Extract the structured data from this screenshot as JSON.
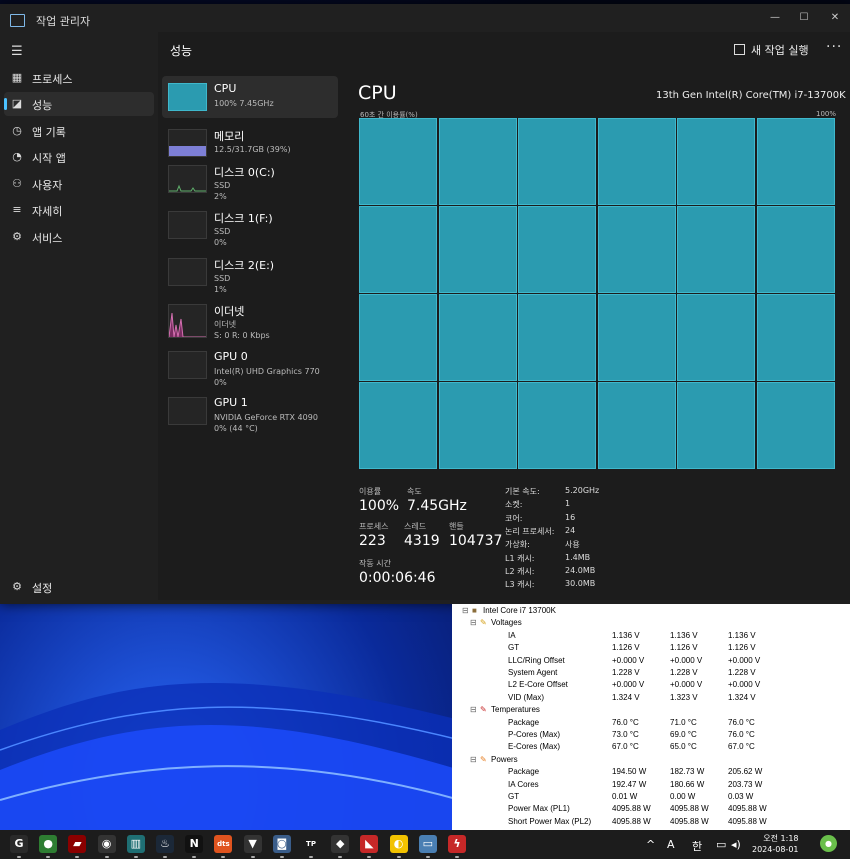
{
  "window": {
    "title": "작업 관리자"
  },
  "nav": {
    "items": [
      {
        "label": "프로세스",
        "icon": "processes-icon"
      },
      {
        "label": "성능",
        "icon": "performance-icon"
      },
      {
        "label": "앱 기록",
        "icon": "app-history-icon"
      },
      {
        "label": "시작 앱",
        "icon": "startup-apps-icon"
      },
      {
        "label": "사용자",
        "icon": "users-icon"
      },
      {
        "label": "자세히",
        "icon": "details-icon"
      },
      {
        "label": "서비스",
        "icon": "services-icon"
      }
    ],
    "settings": "설정"
  },
  "header": {
    "title": "성능",
    "run_task": "새 작업 실행",
    "more": "···"
  },
  "resources": [
    {
      "name": "CPU",
      "sub1": "100% 7.45GHz",
      "sub2": ""
    },
    {
      "name": "메모리",
      "sub1": "12.5/31.7GB (39%)",
      "sub2": ""
    },
    {
      "name": "디스크 0(C:)",
      "sub1": "SSD",
      "sub2": "2%"
    },
    {
      "name": "디스크 1(F:)",
      "sub1": "SSD",
      "sub2": "0%"
    },
    {
      "name": "디스크 2(E:)",
      "sub1": "SSD",
      "sub2": "1%"
    },
    {
      "name": "이더넷",
      "sub1": "이더넷",
      "sub2": "S: 0 R: 0 Kbps"
    },
    {
      "name": "GPU 0",
      "sub1": "Intel(R) UHD Graphics 770",
      "sub2": "0%"
    },
    {
      "name": "GPU 1",
      "sub1": "NVIDIA GeForce RTX 4090",
      "sub2": "0% (44 °C)"
    }
  ],
  "memory_fraction": 0.39,
  "cpu": {
    "heading": "CPU",
    "model": "13th Gen Intel(R) Core(TM) i7-13700K",
    "graph_label": "60초 간 이용률(%)",
    "graph_max": "100%",
    "core_graph_count": 24,
    "core_utilization": 1.0,
    "stats": {
      "util_label": "이용률",
      "util": "100%",
      "speed_label": "속도",
      "speed": "7.45GHz",
      "proc_label": "프로세스",
      "proc": "223",
      "thread_label": "스레드",
      "thread": "4319",
      "handle_label": "핸들",
      "handle": "104737",
      "uptime_label": "작동 시간",
      "uptime": "0:00:06:46"
    },
    "specs": [
      {
        "k": "기본 속도:",
        "v": "5.20GHz"
      },
      {
        "k": "소켓:",
        "v": "1"
      },
      {
        "k": "코어:",
        "v": "16"
      },
      {
        "k": "논리 프로세서:",
        "v": "24"
      },
      {
        "k": "가상화:",
        "v": "사용"
      },
      {
        "k": "L1 캐시:",
        "v": "1.4MB"
      },
      {
        "k": "L2 캐시:",
        "v": "24.0MB"
      },
      {
        "k": "L3 캐시:",
        "v": "30.0MB"
      }
    ]
  },
  "hwinfo": {
    "rows": [
      {
        "label": "Intel Core i7 13700K",
        "c1": "",
        "c2": "",
        "c3": "",
        "level": 0
      },
      {
        "label": "Voltages",
        "c1": "",
        "c2": "",
        "c3": "",
        "level": 1
      },
      {
        "label": "IA",
        "c1": "1.136 V",
        "c2": "1.136 V",
        "c3": "1.136 V",
        "level": 2
      },
      {
        "label": "GT",
        "c1": "1.126 V",
        "c2": "1.126 V",
        "c3": "1.126 V",
        "level": 2
      },
      {
        "label": "LLC/Ring Offset",
        "c1": "+0.000 V",
        "c2": "+0.000 V",
        "c3": "+0.000 V",
        "level": 2
      },
      {
        "label": "System Agent",
        "c1": "1.228 V",
        "c2": "1.228 V",
        "c3": "1.228 V",
        "level": 2
      },
      {
        "label": "L2 E-Core Offset",
        "c1": "+0.000 V",
        "c2": "+0.000 V",
        "c3": "+0.000 V",
        "level": 2
      },
      {
        "label": "VID (Max)",
        "c1": "1.324 V",
        "c2": "1.323 V",
        "c3": "1.324 V",
        "level": 2
      },
      {
        "label": "Temperatures",
        "c1": "",
        "c2": "",
        "c3": "",
        "level": 1
      },
      {
        "label": "Package",
        "c1": "76.0 °C",
        "c2": "71.0 °C",
        "c3": "76.0 °C",
        "level": 2
      },
      {
        "label": "P-Cores (Max)",
        "c1": "73.0 °C",
        "c2": "69.0 °C",
        "c3": "76.0 °C",
        "level": 2
      },
      {
        "label": "E-Cores (Max)",
        "c1": "67.0 °C",
        "c2": "65.0 °C",
        "c3": "67.0 °C",
        "level": 2
      },
      {
        "label": "Powers",
        "c1": "",
        "c2": "",
        "c3": "",
        "level": 1
      },
      {
        "label": "Package",
        "c1": "194.50 W",
        "c2": "182.73 W",
        "c3": "205.62 W",
        "level": 2
      },
      {
        "label": "IA Cores",
        "c1": "192.47 W",
        "c2": "180.66 W",
        "c3": "203.73 W",
        "level": 2
      },
      {
        "label": "GT",
        "c1": "0.01 W",
        "c2": "0.00 W",
        "c3": "0.03 W",
        "level": 2
      },
      {
        "label": "Power Max (PL1)",
        "c1": "4095.88 W",
        "c2": "4095.88 W",
        "c3": "4095.88 W",
        "level": 2
      },
      {
        "label": "Short Power Max (PL2)",
        "c1": "4095.88 W",
        "c2": "4095.88 W",
        "c3": "4095.88 W",
        "level": 2
      }
    ]
  },
  "taskbar": {
    "apps": [
      {
        "name": "g-hub-icon",
        "glyph": "G",
        "color": "#2a2a2a"
      },
      {
        "name": "green-app-icon",
        "glyph": "●",
        "color": "#2e7d32"
      },
      {
        "name": "msi-afterburner-icon",
        "glyph": "▰",
        "color": "#8b0000"
      },
      {
        "name": "obs-icon",
        "glyph": "◉",
        "color": "#333"
      },
      {
        "name": "hwinfo-icon",
        "glyph": "▥",
        "color": "#1f6f74"
      },
      {
        "name": "steam-icon",
        "glyph": "♨",
        "color": "#1b2838"
      },
      {
        "name": "netflix-icon",
        "glyph": "N",
        "color": "#111"
      },
      {
        "name": "dts-icon",
        "glyph": "dts",
        "color": "#e0541f"
      },
      {
        "name": "nvidia-icon",
        "glyph": "▼",
        "color": "#333"
      },
      {
        "name": "camera-icon",
        "glyph": "◙",
        "color": "#3a5d8a"
      },
      {
        "name": "tp-app-icon",
        "glyph": "TP",
        "color": "#1c1c1c"
      },
      {
        "name": "cat-app-icon",
        "glyph": "◆",
        "color": "#333"
      },
      {
        "name": "amd-icon",
        "glyph": "◣",
        "color": "#c62828"
      },
      {
        "name": "duck-app-icon",
        "glyph": "◐",
        "color": "#f2c200"
      },
      {
        "name": "task-manager-icon",
        "glyph": "▭",
        "color": "#4a7fb3"
      },
      {
        "name": "bolt-app-icon",
        "glyph": "ϟ",
        "color": "#c62828"
      }
    ],
    "tray": {
      "chevron": "^",
      "ime_a": "A",
      "ime_han": "한"
    },
    "time": "오전 1:18",
    "date": "2024-08-01"
  }
}
